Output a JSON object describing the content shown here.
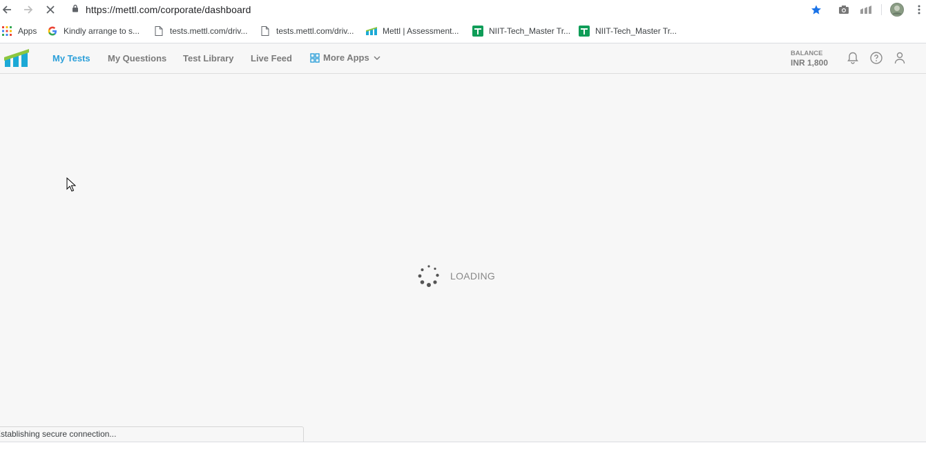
{
  "browser": {
    "url": "https://mettl.com/corporate/dashboard",
    "bookmarks": [
      {
        "label": "Apps",
        "icon": "apps-grid-icon"
      },
      {
        "label": "Kindly arrange to s...",
        "icon": "google-icon"
      },
      {
        "label": "tests.mettl.com/driv...",
        "icon": "page-icon"
      },
      {
        "label": "tests.mettl.com/driv...",
        "icon": "page-icon"
      },
      {
        "label": "Mettl | Assessment...",
        "icon": "mettl-icon"
      },
      {
        "label": "NIIT-Tech_Master Tr...",
        "icon": "sheets-icon"
      },
      {
        "label": "NIIT-Tech_Master Tr...",
        "icon": "sheets-icon"
      }
    ],
    "status_text": "Establishing secure connection..."
  },
  "header": {
    "nav": [
      "My Tests",
      "My Questions",
      "Test Library",
      "Live Feed"
    ],
    "active_nav": "My Tests",
    "more_apps": "More Apps",
    "balance_label": "BALANCE",
    "balance_value": "INR 1,800"
  },
  "main": {
    "loading_text": "LOADING"
  },
  "colors": {
    "accent": "#2b9fd9",
    "logo_green": "#8cc63f",
    "logo_blue": "#1ca9d6",
    "star": "#1a73e8"
  }
}
